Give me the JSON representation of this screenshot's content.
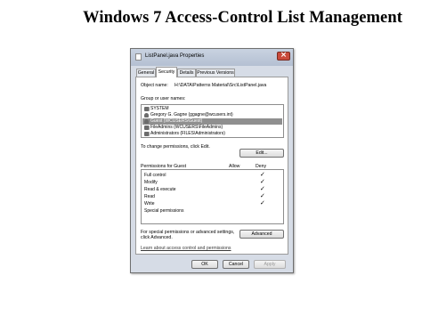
{
  "slide": {
    "title": "Windows 7 Access-Control List Management"
  },
  "window": {
    "title": "ListPanel.java Properties",
    "close_glyph": "×",
    "tabs": [
      {
        "label": "General",
        "active": false
      },
      {
        "label": "Security",
        "active": true
      },
      {
        "label": "Details",
        "active": false
      },
      {
        "label": "Previous Versions",
        "active": false
      }
    ]
  },
  "security": {
    "object_name_label": "Object name:",
    "object_name_value": "H:\\DATA\\Patterns Material\\Src\\ListPanel.java",
    "group_label": "Group or user names:",
    "users": [
      {
        "name": "SYSTEM",
        "icon": "group-icon",
        "selected": false
      },
      {
        "name": "Gregory G. Gagne (ggagne@wcusers.int)",
        "icon": "person-icon",
        "selected": false
      },
      {
        "name": "Guest (WCUSERS\\Guest)",
        "icon": "person-icon",
        "selected": true
      },
      {
        "name": "FileAdmins (WCUSERS\\FileAdmins)",
        "icon": "group-icon",
        "selected": false
      },
      {
        "name": "Administrators (FILES\\Administrators)",
        "icon": "group-icon",
        "selected": false
      }
    ],
    "change_text": "To change permissions, click Edit.",
    "edit_button": "Edit...",
    "permissions_header": "Permissions for Guest",
    "allow_header": "Allow",
    "deny_header": "Deny",
    "permissions": [
      {
        "name": "Full control",
        "allow": false,
        "deny": true
      },
      {
        "name": "Modify",
        "allow": false,
        "deny": true
      },
      {
        "name": "Read & execute",
        "allow": false,
        "deny": true
      },
      {
        "name": "Read",
        "allow": false,
        "deny": true
      },
      {
        "name": "Write",
        "allow": false,
        "deny": true
      },
      {
        "name": "Special permissions",
        "allow": false,
        "deny": false
      }
    ],
    "check_glyph": "✓",
    "special_text_1": "For special permissions or advanced settings,",
    "special_text_2": "click Advanced.",
    "advanced_button": "Advanced",
    "learn_link": "Learn about access control and permissions"
  },
  "footer": {
    "ok": "OK",
    "cancel": "Cancel",
    "apply": "Apply"
  },
  "colors": {
    "selection": "#8f8f8f",
    "frame": "#d6dce6"
  }
}
